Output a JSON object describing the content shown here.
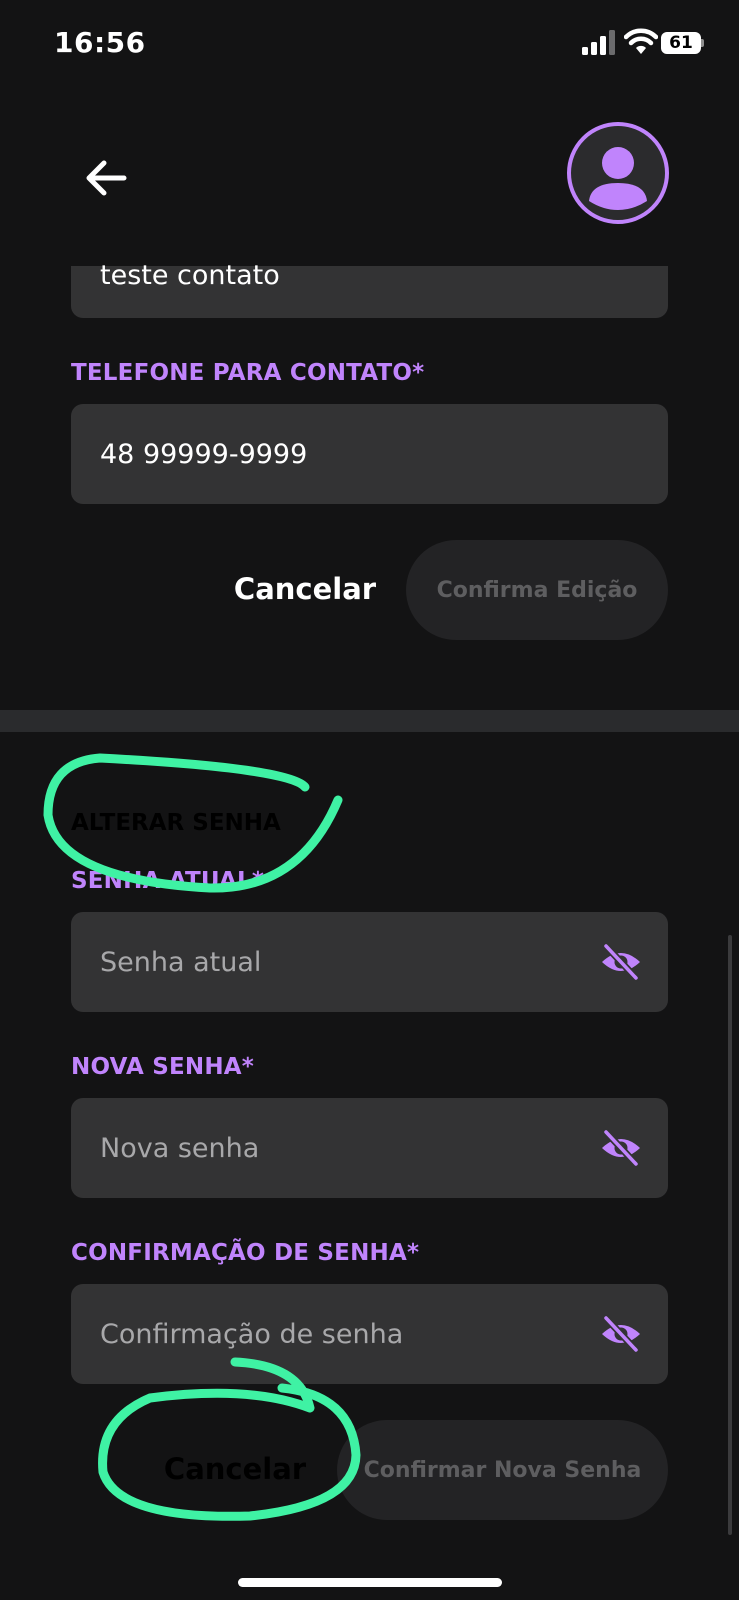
{
  "status_bar": {
    "time": "16:56",
    "battery": "61",
    "signal_icon": "cellular-signal-icon",
    "wifi_icon": "wifi-icon"
  },
  "header": {
    "back_icon": "arrow-left-icon",
    "avatar_icon": "user-avatar-icon"
  },
  "contact_form": {
    "contact_field_value": "teste contato",
    "phone_label": "TELEFONE PARA CONTATO*",
    "phone_value": "48 99999-9999",
    "cancel_label": "Cancelar",
    "confirm_label": "Confirma Edição"
  },
  "password_form": {
    "section_title": "ALTERAR SENHA",
    "current_label": "SENHA ATUAL*",
    "current_placeholder": "Senha atual",
    "new_label": "NOVA SENHA*",
    "new_placeholder": "Nova senha",
    "confirm_label": "CONFIRMAÇÃO DE SENHA*",
    "confirm_placeholder": "Confirmação de senha",
    "cancel_label": "Cancelar",
    "submit_label": "Confirmar Nova Senha"
  },
  "colors": {
    "background": "#131314",
    "field": "#333334",
    "accent": "#c084fc",
    "annotation": "#3ff2a4"
  }
}
